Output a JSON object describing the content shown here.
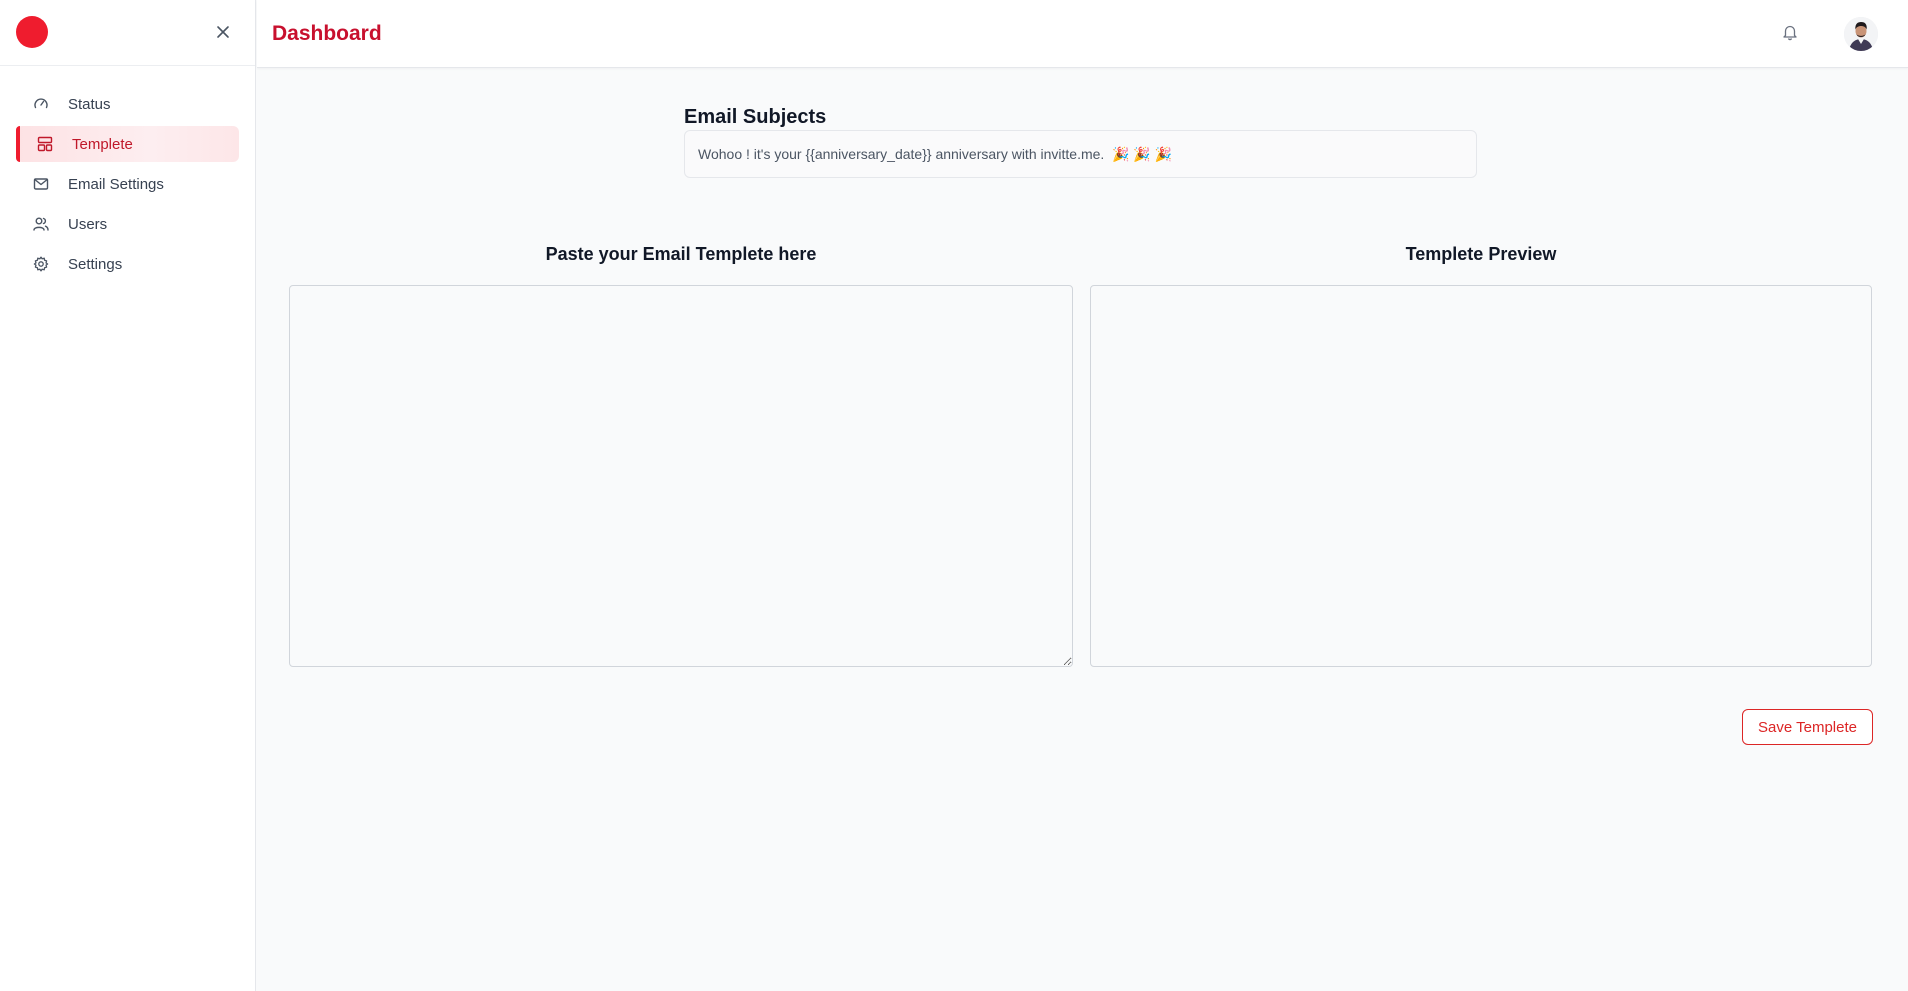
{
  "app": {
    "brand_color": "#ef1c2e",
    "accent_color": "#c8102e"
  },
  "sidebar": {
    "items": [
      {
        "label": "Status",
        "icon": "gauge-icon",
        "active": false
      },
      {
        "label": "Templete",
        "icon": "layout-template-icon",
        "active": true
      },
      {
        "label": "Email Settings",
        "icon": "mail-icon",
        "active": false
      },
      {
        "label": "Users",
        "icon": "users-icon",
        "active": false
      },
      {
        "label": "Settings",
        "icon": "gear-icon",
        "active": false
      }
    ]
  },
  "header": {
    "title": "Dashboard"
  },
  "subject": {
    "label": "Email Subjects",
    "value": "Wohoo ! it's your {{anniversary_date}} anniversary with invitte.me.  🎉 🎉 🎉"
  },
  "editor": {
    "template_title": "Paste your Email Templete here",
    "preview_title": "Templete Preview",
    "template_value": ""
  },
  "actions": {
    "save_label": "Save Templete"
  }
}
